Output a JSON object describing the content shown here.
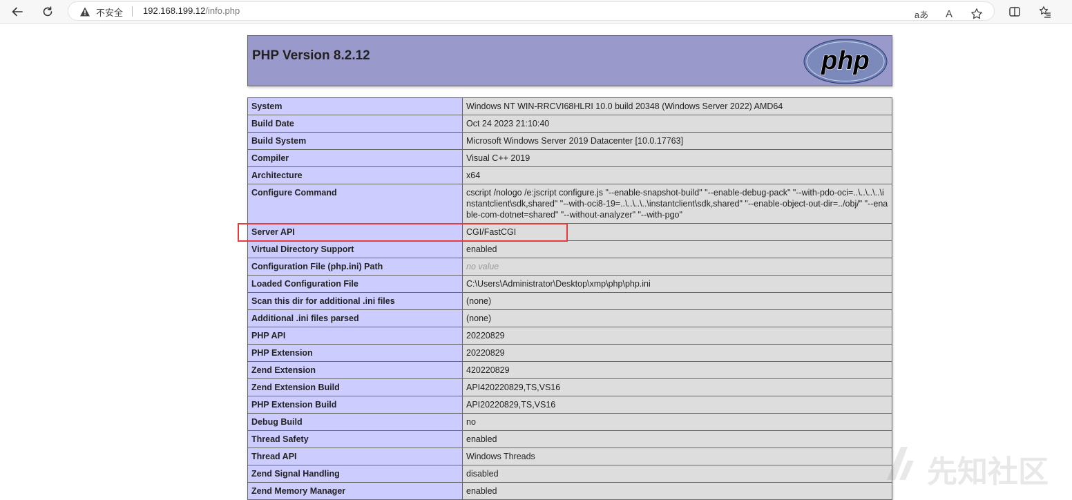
{
  "browser": {
    "security_label": "不安全",
    "url_host": "192.168.199.12",
    "url_path": "/info.php",
    "read_aloud_label": "aあ",
    "text_size_label": "A"
  },
  "php": {
    "title": "PHP Version 8.2.12",
    "logo_text": "php"
  },
  "info_rows": [
    {
      "key": "System",
      "value": "Windows NT WIN-RRCVI68HLRI 10.0 build 20348 (Windows Server 2022) AMD64"
    },
    {
      "key": "Build Date",
      "value": "Oct 24 2023 21:10:40"
    },
    {
      "key": "Build System",
      "value": "Microsoft Windows Server 2019 Datacenter [10.0.17763]"
    },
    {
      "key": "Compiler",
      "value": "Visual C++ 2019"
    },
    {
      "key": "Architecture",
      "value": "x64"
    },
    {
      "key": "Configure Command",
      "value": "cscript /nologo /e:jscript configure.js \"--enable-snapshot-build\" \"--enable-debug-pack\" \"--with-pdo-oci=..\\..\\..\\..\\instantclient\\sdk,shared\" \"--with-oci8-19=..\\..\\..\\..\\instantclient\\sdk,shared\" \"--enable-object-out-dir=../obj/\" \"--enable-com-dotnet=shared\" \"--without-analyzer\" \"--with-pgo\""
    },
    {
      "key": "Server API",
      "value": "CGI/FastCGI"
    },
    {
      "key": "Virtual Directory Support",
      "value": "enabled"
    },
    {
      "key": "Configuration File (php.ini) Path",
      "value": "no value"
    },
    {
      "key": "Loaded Configuration File",
      "value": "C:\\Users\\Administrator\\Desktop\\xmp\\php\\php.ini"
    },
    {
      "key": "Scan this dir for additional .ini files",
      "value": "(none)"
    },
    {
      "key": "Additional .ini files parsed",
      "value": "(none)"
    },
    {
      "key": "PHP API",
      "value": "20220829"
    },
    {
      "key": "PHP Extension",
      "value": "20220829"
    },
    {
      "key": "Zend Extension",
      "value": "420220829"
    },
    {
      "key": "Zend Extension Build",
      "value": "API420220829,TS,VS16"
    },
    {
      "key": "PHP Extension Build",
      "value": "API20220829,TS,VS16"
    },
    {
      "key": "Debug Build",
      "value": "no"
    },
    {
      "key": "Thread Safety",
      "value": "enabled"
    },
    {
      "key": "Thread API",
      "value": "Windows Threads"
    },
    {
      "key": "Zend Signal Handling",
      "value": "disabled"
    },
    {
      "key": "Zend Memory Manager",
      "value": "enabled"
    }
  ],
  "watermark": {
    "text": "先知社区"
  },
  "colors": {
    "header_bg": "#9999cc",
    "key_bg": "#ccccff",
    "value_bg": "#dddddd",
    "highlight": "#e83a3a"
  }
}
